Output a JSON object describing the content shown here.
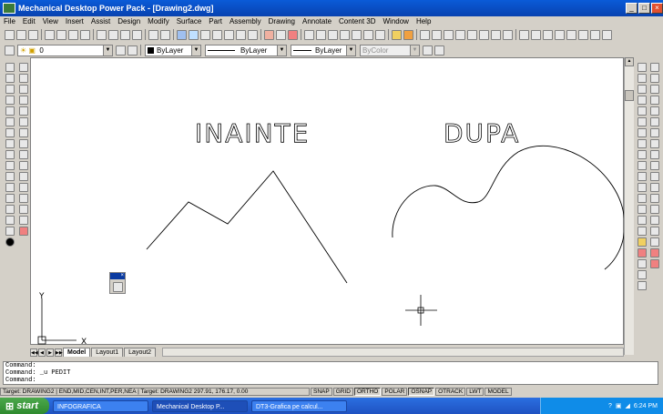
{
  "window": {
    "title": "Mechanical Desktop Power Pack - [Drawing2.dwg]"
  },
  "menu": [
    "File",
    "Edit",
    "View",
    "Insert",
    "Assist",
    "Design",
    "Modify",
    "Surface",
    "Part",
    "Assembly",
    "Drawing",
    "Annotate",
    "Content 3D",
    "Window",
    "Help"
  ],
  "properties_bar": {
    "layer_value": "0",
    "color_value": "ByLayer",
    "linetype_value": "ByLayer",
    "lineweight_value": "ByLayer",
    "plotstyle_value": "ByColor"
  },
  "drawing": {
    "label_before": "INAINTE",
    "label_after": "DUPA",
    "ucs_y": "Y",
    "ucs_x": "X"
  },
  "tabs": [
    "Model",
    "Layout1",
    "Layout2"
  ],
  "command_lines": [
    "Command:",
    "Command: _u PEDIT",
    "Command:"
  ],
  "status": {
    "info": "Target: DRAWING2 | END,MID,CEN,INT,PER,NEA | Target: DRAWING2  297.91, 176.17, 0.00",
    "toggles": [
      "SNAP",
      "GRID",
      "ORTHO",
      "POLAR",
      "OSNAP",
      "OTRACK",
      "LWT",
      "MODEL"
    ]
  },
  "taskbar": {
    "start": "start",
    "tasks": [
      "INFOGRAFICA",
      "Mechanical Desktop P...",
      "DT3-Grafica pe calcul..."
    ],
    "clock": "6:24 PM"
  }
}
